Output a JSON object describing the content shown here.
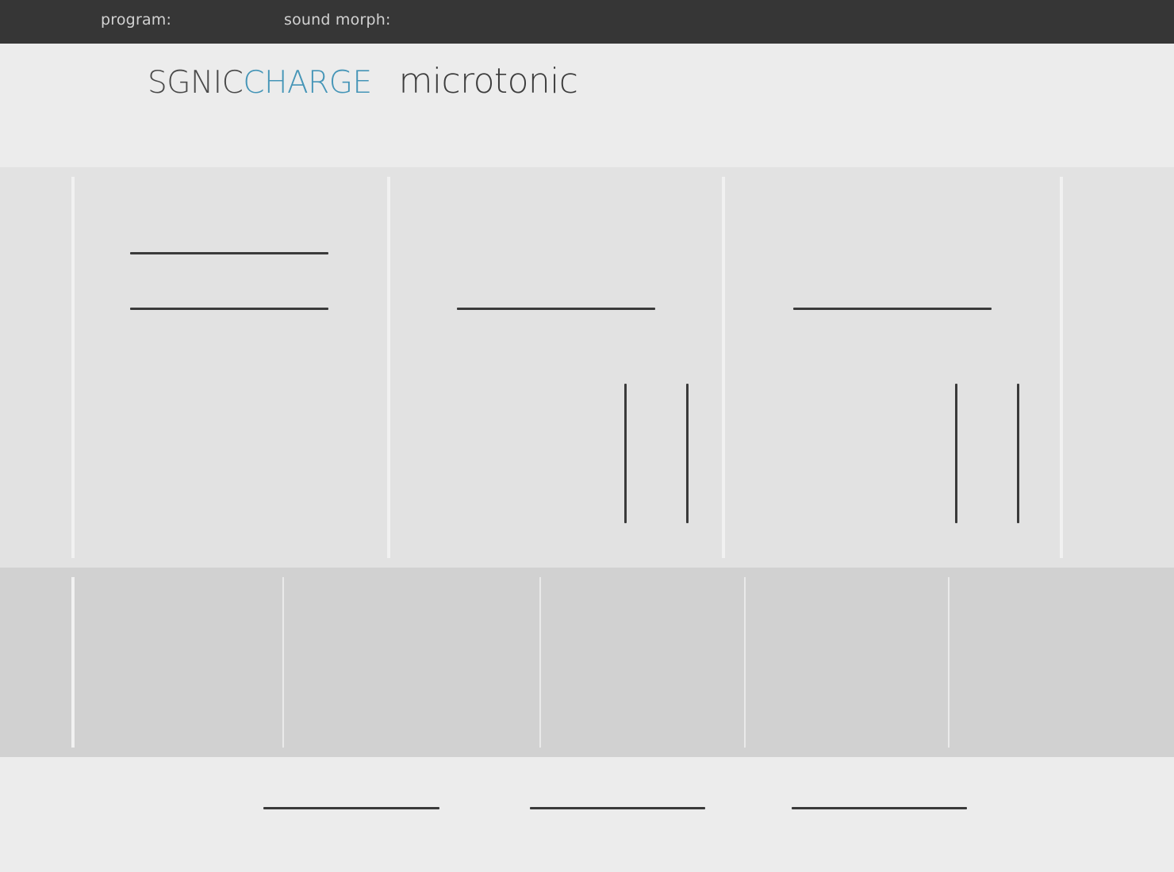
{
  "header": {
    "program_label": "program:",
    "program_value": "",
    "sound_morph_label": "sound morph:",
    "sound_morph_value": ""
  },
  "brand": {
    "vendor_part1": "SGNIC",
    "vendor_part2": "CHARGE",
    "product": "microtonic",
    "colors": {
      "vendor_dark": "#4a4a4a",
      "vendor_accent": "#4595b7",
      "product": "#3d3d3d"
    }
  },
  "voice_section": {
    "columns": [
      "",
      "",
      ""
    ],
    "fields": [
      "",
      "",
      "",
      "",
      ""
    ],
    "faders": [
      "",
      "",
      "",
      ""
    ]
  },
  "mix_section": {
    "columns": [
      "",
      "",
      "",
      "",
      ""
    ]
  },
  "footer": {
    "fields": [
      "",
      "",
      ""
    ]
  },
  "colors": {
    "topbar": "#363636",
    "background": "#ececec",
    "voice_panel": "#e2e2e2",
    "mix_panel": "#d1d1d1",
    "line": "#3a3a3a"
  }
}
